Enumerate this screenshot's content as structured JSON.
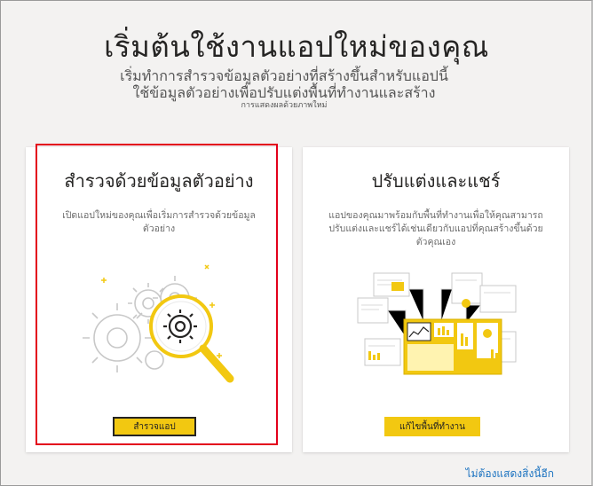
{
  "header": {
    "title": "เริ่มต้นใช้งานแอปใหม่ของคุณ",
    "subtitle_line1": "เริ่มทำการสำรวจข้อมูลตัวอย่างที่สร้างขึ้นสำหรับแอปนี้",
    "subtitle_line2": "ใช้ข้อมูลตัวอย่างเพื่อปรับแต่งพื้นที่ทำงานและสร้าง",
    "subtitle_line3": "การแสดงผลด้วยภาพใหม่"
  },
  "cards": [
    {
      "title": "สำรวจด้วยข้อมูลตัวอย่าง",
      "description": "เปิดแอปใหม่ของคุณเพื่อเริ่มการสำรวจด้วยข้อมูลตัวอย่าง",
      "button_label": "สำรวจแอป",
      "icon": "magnifier-gears-icon",
      "selected": true
    },
    {
      "title": "ปรับแต่งและแชร์",
      "description": "แอปของคุณมาพร้อมกับพื้นที่ทำงานเพื่อให้คุณสามารถปรับแต่งและแชร์ได้เช่นเดียวกับแอปที่คุณสร้างขึ้นด้วยตัวคุณเอง",
      "button_label": "แก้ไขพื้นที่ทำงาน",
      "icon": "dashboard-reports-icon",
      "selected": false
    }
  ],
  "footer": {
    "dismiss_link": "ไม่ต้องแสดงสิ่งนี้อีก"
  },
  "colors": {
    "accent": "#f2c811",
    "highlight": "#e3001b",
    "link": "#1a72c0"
  }
}
